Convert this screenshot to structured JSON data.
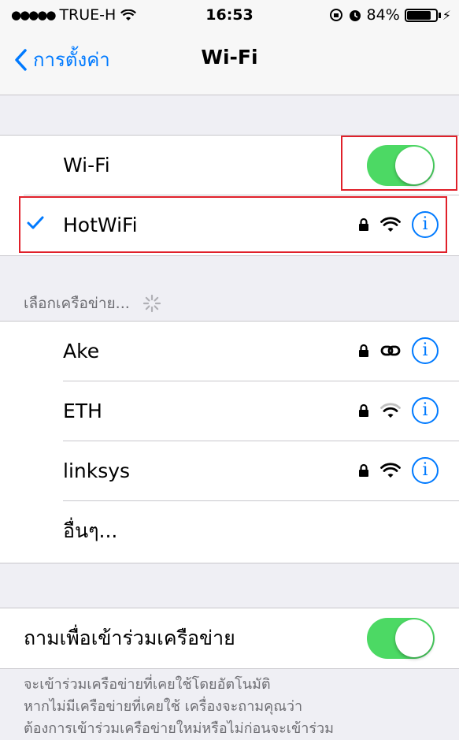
{
  "status_bar": {
    "signal": "●●●●●",
    "carrier": "TRUE-H",
    "time": "16:53",
    "battery_percent": "84%",
    "battery_level": 0.84
  },
  "nav": {
    "back_label": "การตั้งค่า",
    "title": "Wi-Fi"
  },
  "wifi_toggle": {
    "label": "Wi-Fi",
    "on": true
  },
  "connected_network": {
    "name": "HotWiFi",
    "secured": true,
    "icon": "wifi-icon"
  },
  "choose_network": {
    "header": "เลือกเครือข่าย..."
  },
  "networks": [
    {
      "name": "Ake",
      "secured": true,
      "icon": "link-icon"
    },
    {
      "name": "ETH",
      "secured": true,
      "icon": "wifi-icon"
    },
    {
      "name": "linksys",
      "secured": true,
      "icon": "wifi-icon"
    }
  ],
  "other_label": "อื่นๆ...",
  "ask_to_join": {
    "label": "ถามเพื่อเข้าร่วมเครือข่าย",
    "on": true
  },
  "footer": {
    "line1": "จะเข้าร่วมเครือข่ายที่เคยใช้โดยอัตโนมัติ",
    "line2": "หากไม่มีเครือข่ายที่เคยใช้ เครื่องจะถามคุณว่า",
    "line3": "ต้องการเข้าร่วมเครือข่ายใหม่หรือไม่ก่อนจะเข้าร่วม"
  },
  "colors": {
    "accent": "#007aff",
    "toggle_on": "#4cd964",
    "highlight": "#e0202a"
  }
}
